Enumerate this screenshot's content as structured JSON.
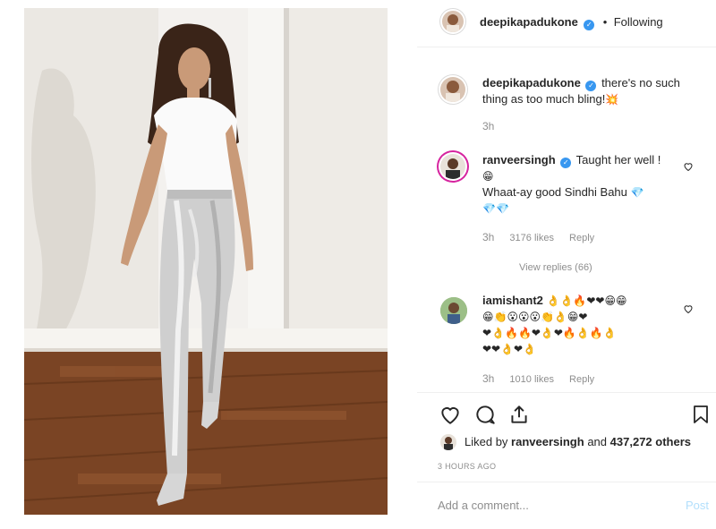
{
  "post_author": {
    "username": "deepikapadukone",
    "follow_status": "Following"
  },
  "caption": {
    "username": "deepikapadukone",
    "text": "there's no such thing as too much bling!",
    "emoji": "💥",
    "time": "3h"
  },
  "comments": [
    {
      "username": "ranveersingh",
      "line1": "Taught her well !",
      "line1_emoji": "😁",
      "line2": "Whaat-ay good Sindhi Bahu",
      "line2_emoji": "💎",
      "line3_emoji": "💎💎",
      "time": "3h",
      "likes": "3176 likes",
      "reply_label": "Reply",
      "view_replies": "View replies (66)"
    },
    {
      "username": "iamishant2",
      "emoji_line1": "👌👌🔥❤❤😁😁",
      "emoji_line2": "😁👏😮😮😮👏👌😁❤",
      "emoji_line3": "❤👌🔥🔥❤👌❤🔥👌🔥👌",
      "emoji_line4": "❤❤👌❤👌",
      "time": "3h",
      "likes": "1010 likes",
      "reply_label": "Reply"
    }
  ],
  "liked_by": {
    "prefix": "Liked by",
    "user": "ranveersingh",
    "joiner": "and",
    "others": "437,272 others"
  },
  "timestamp": "3 HOURS AGO",
  "add_comment": {
    "placeholder": "Add a comment...",
    "post_label": "Post"
  },
  "colors": {
    "link_blue": "#3897f0",
    "post_disabled": "#b2dffc",
    "muted": "#8e8e8e",
    "text": "#262626"
  },
  "icons": [
    "heart-icon",
    "comment-icon",
    "share-icon",
    "bookmark-icon",
    "verified-icon"
  ]
}
